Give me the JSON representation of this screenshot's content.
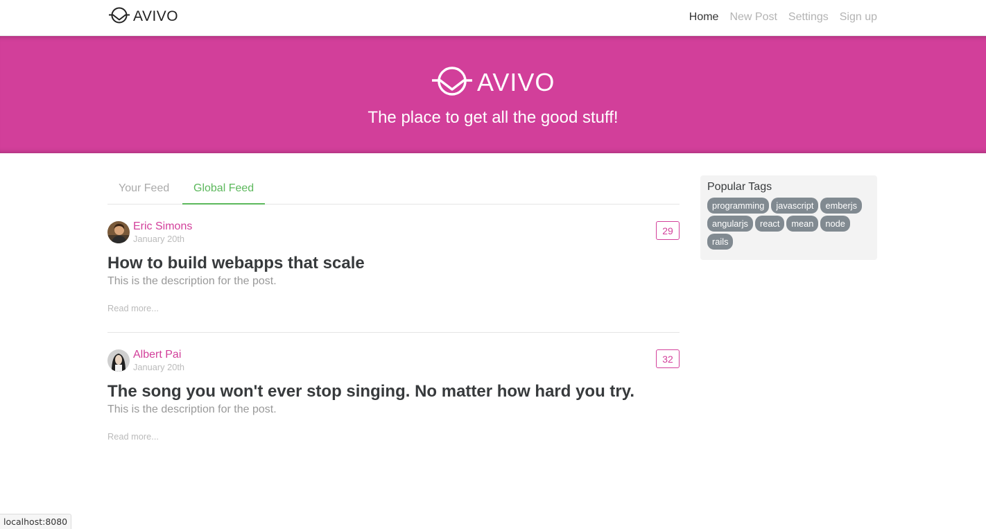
{
  "nav": {
    "brand": "AVIVO",
    "links": [
      "Home",
      "New Post",
      "Settings",
      "Sign up"
    ],
    "active_index": 0
  },
  "banner": {
    "logo_text": "AVIVO",
    "tagline": "The place to get all the good stuff!",
    "color": "#d23f9a"
  },
  "feed": {
    "tabs": [
      "Your Feed",
      "Global Feed"
    ],
    "active_tab": 1,
    "articles": [
      {
        "author": "Eric Simons",
        "date": "January 20th",
        "favorites": "29",
        "title": "How to build webapps that scale",
        "description": "This is the description for the post.",
        "read_more": "Read more..."
      },
      {
        "author": "Albert Pai",
        "date": "January 20th",
        "favorites": "32",
        "title": "The song you won't ever stop singing. No matter how hard you try.",
        "description": "This is the description for the post.",
        "read_more": "Read more..."
      }
    ]
  },
  "sidebar": {
    "title": "Popular Tags",
    "tags": [
      "programming",
      "javascript",
      "emberjs",
      "angularjs",
      "react",
      "mean",
      "node",
      "rails"
    ]
  },
  "status_bar": {
    "url": "localhost:8080"
  },
  "colors": {
    "accent": "#d23f9a",
    "active_tab": "#5cb85c",
    "tag_bg": "#818a91"
  },
  "icons": {
    "brand_logo": "avivo-logo-icon",
    "avatar": "user-avatar"
  }
}
